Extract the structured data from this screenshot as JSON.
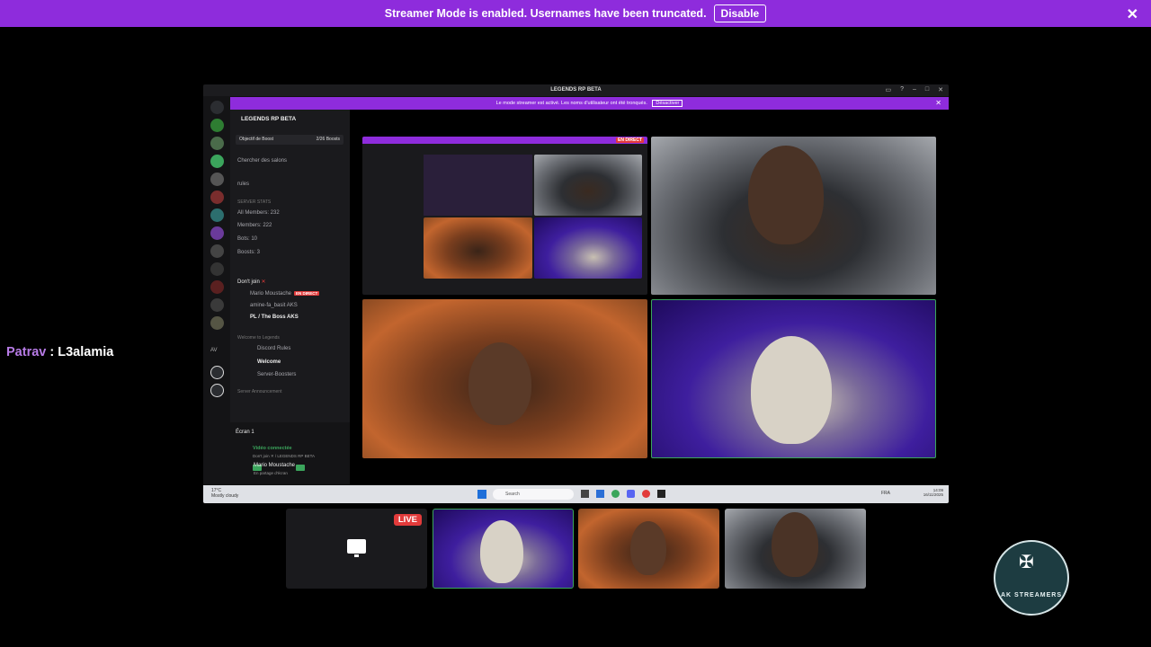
{
  "streamer_banner": {
    "message": "Streamer Mode is enabled. Usernames have been truncated.",
    "disable_label": "Disable"
  },
  "chat": {
    "user": "Patrav",
    "separator": " : ",
    "message": "L3alamia"
  },
  "shared_screen": {
    "window_title": "LEGENDS RP BETA",
    "inner_banner": {
      "message": "Le mode streamer est activé. Les noms d'utilisateur ont été tronqués.",
      "disable_label": "Désactiver"
    },
    "server_name": "LEGENDS RP BETA",
    "boost": {
      "label": "Objectif de Boost",
      "count": "2/26 Boosts"
    },
    "search_channels": "Chercher des salons",
    "channels": [
      {
        "name": "rules"
      },
      {
        "name": "SERVER STATS"
      },
      {
        "name": "All Members: 232"
      },
      {
        "name": "Members: 222"
      },
      {
        "name": "Bots: 10"
      },
      {
        "name": "Boosts: 3"
      }
    ],
    "voice_channel": {
      "name": "Don't join",
      "members": [
        {
          "name": "Mario Moustache",
          "badge": "EN DIRECT"
        },
        {
          "name": "amine-fa_basit",
          "badge": "AKS"
        },
        {
          "name": "PL / The Boss",
          "badge": "AKS"
        }
      ]
    },
    "category_welcome": "Welcome to Legends",
    "welcome_channels": [
      "Discord Rules",
      "Welcome",
      "Server-Boosters"
    ],
    "category_announcement": "Server Announcement",
    "voice_panel": {
      "screen": "Écran 1",
      "connected": "Vidéo connectée",
      "sub": "Don't join ✕ / LEGENDS RP BETA"
    },
    "user": {
      "name": "Mario Moustache",
      "status": "En partage d'écran"
    },
    "guild_label": "AV",
    "nested_live": "EN DIRECT",
    "taskbar": {
      "weather_temp": "17°C",
      "weather_desc": "Mostly cloudy",
      "search": "Search",
      "lang": "FRA",
      "time": "14:09",
      "date": "16/11/2025"
    }
  },
  "thumbnails": {
    "live_label": "LIVE"
  },
  "logo": {
    "text": "AK STREAMERS"
  }
}
